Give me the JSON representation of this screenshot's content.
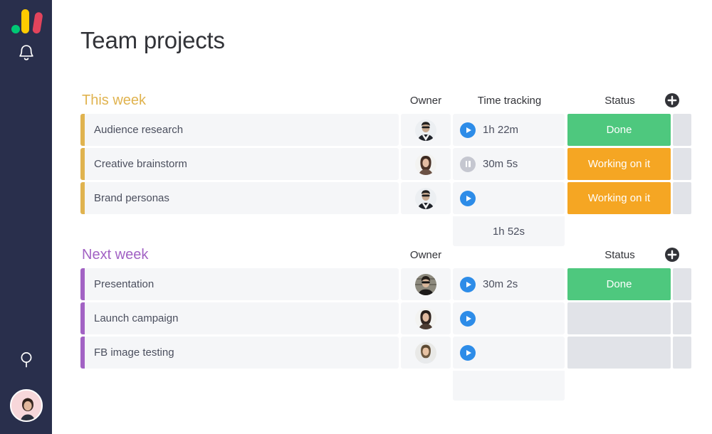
{
  "sidebar": {
    "logo_name": "monday-logo",
    "items": [
      {
        "name": "notifications-bell-icon",
        "label": "Notifications"
      },
      {
        "name": "search-icon",
        "label": "Search"
      },
      {
        "name": "user-avatar",
        "label": "My profile"
      }
    ],
    "background_color": "#292f4c",
    "logo_colors": {
      "dot": "#00c875",
      "bar_yellow": "#fdcb00",
      "bar_red": "#e2445c"
    }
  },
  "header": {
    "title": "Team projects"
  },
  "colors": {
    "status_done": "#4ec87e",
    "status_working": "#f5a623",
    "status_empty": "#e1e3e8",
    "group_this_week": "#e0b34f",
    "group_next_week": "#a262c4",
    "row_bg": "#f5f6f8",
    "timer_play": "#2d8ce8",
    "timer_pause": "#c5c7d0"
  },
  "groups": [
    {
      "name": "This week",
      "color": "#e0b34f",
      "columns": {
        "owner": "Owner",
        "time": "Time tracking",
        "status": "Status"
      },
      "add_column_label": "+",
      "rows": [
        {
          "task": "Audience research",
          "owner": "avatar-man-suit",
          "time": "1h 22m",
          "timer": "play",
          "status": "Done",
          "status_color": "#4ec87e"
        },
        {
          "task": "Creative brainstorm",
          "owner": "avatar-woman-long",
          "time": "30m 5s",
          "timer": "pause",
          "status": "Working on it",
          "status_color": "#f5a623"
        },
        {
          "task": "Brand personas",
          "owner": "avatar-man-suit",
          "time": "",
          "timer": "play",
          "status": "Working on it",
          "status_color": "#f5a623"
        }
      ],
      "time_total": "1h 52s"
    },
    {
      "name": "Next week",
      "color": "#a262c4",
      "columns": {
        "owner": "Owner",
        "time": "",
        "status": "Status"
      },
      "add_column_label": "+",
      "rows": [
        {
          "task": "Presentation",
          "owner": "avatar-sunglasses",
          "time": "30m 2s",
          "timer": "play",
          "status": "Done",
          "status_color": "#4ec87e"
        },
        {
          "task": "Launch campaign",
          "owner": "avatar-woman-dark",
          "time": "",
          "timer": "play",
          "status": "",
          "status_color": "#e1e3e8"
        },
        {
          "task": "FB image testing",
          "owner": "avatar-woman-blond",
          "time": "",
          "timer": "play",
          "status": "",
          "status_color": "#e1e3e8"
        }
      ],
      "time_total": ""
    }
  ]
}
